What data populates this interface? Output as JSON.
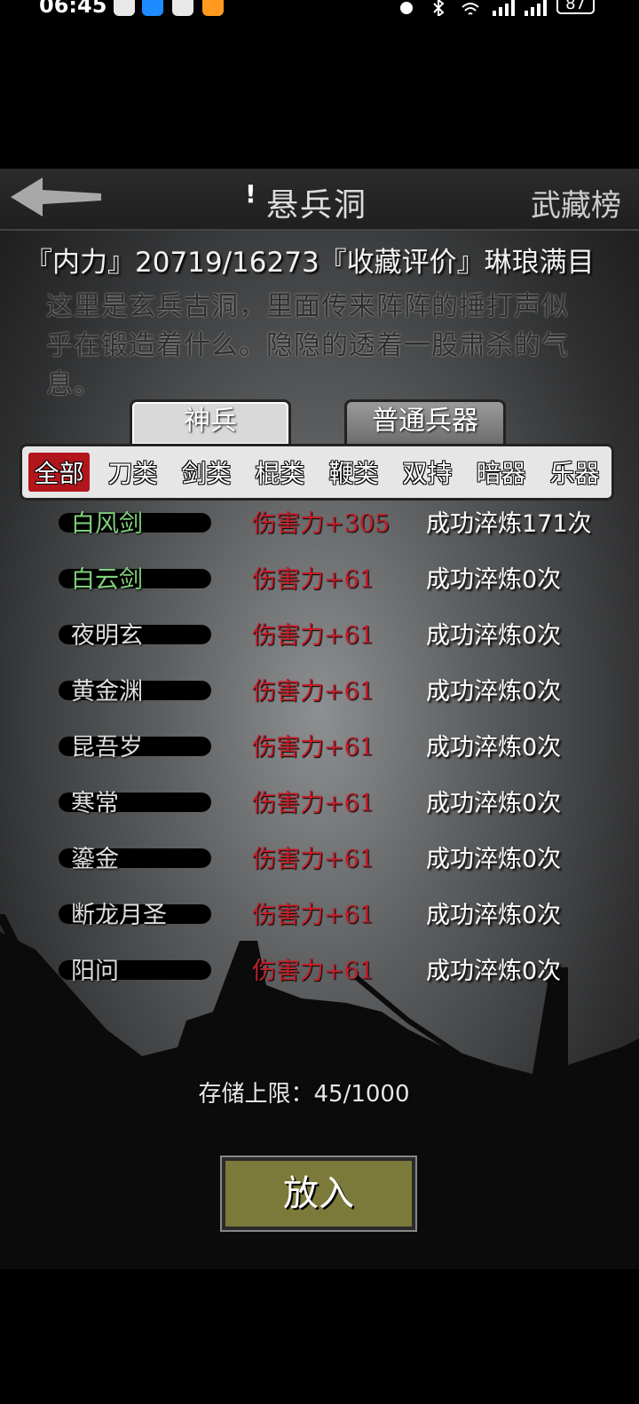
{
  "status_bar": {
    "time": "06:45",
    "battery": "87"
  },
  "header": {
    "title_mark": "!",
    "title": "悬兵洞",
    "ranking_label": "武藏榜"
  },
  "stats_line": "『内力』20719/16273『收藏评价』琳琅满目",
  "description": "这里是玄兵古洞，里面传来阵阵的捶打声似乎在锻造着什么。隐隐的透着一股肃杀的气息。",
  "tabs": [
    {
      "label": "神兵",
      "active": true
    },
    {
      "label": "普通兵器",
      "active": false
    }
  ],
  "categories": [
    {
      "label": "全部",
      "active": true
    },
    {
      "label": "刀类"
    },
    {
      "label": "剑类"
    },
    {
      "label": "棍类"
    },
    {
      "label": "鞭类"
    },
    {
      "label": "双持"
    },
    {
      "label": "暗器"
    },
    {
      "label": "乐器"
    }
  ],
  "weapons": [
    {
      "name": "白风剑",
      "damage": "伤害力+305",
      "refine": "成功淬炼171次",
      "name_color": "green"
    },
    {
      "name": "白云剑",
      "damage": "伤害力+61",
      "refine": "成功淬炼0次",
      "name_color": "green"
    },
    {
      "name": "夜明玄",
      "damage": "伤害力+61",
      "refine": "成功淬炼0次",
      "name_color": "white"
    },
    {
      "name": "黄金渊",
      "damage": "伤害力+61",
      "refine": "成功淬炼0次",
      "name_color": "white"
    },
    {
      "name": "昆吾岁",
      "damage": "伤害力+61",
      "refine": "成功淬炼0次",
      "name_color": "white"
    },
    {
      "name": "寒常",
      "damage": "伤害力+61",
      "refine": "成功淬炼0次",
      "name_color": "white"
    },
    {
      "name": "鎏金",
      "damage": "伤害力+61",
      "refine": "成功淬炼0次",
      "name_color": "white"
    },
    {
      "name": "断龙月圣",
      "damage": "伤害力+61",
      "refine": "成功淬炼0次",
      "name_color": "white"
    },
    {
      "name": "阳问",
      "damage": "伤害力+61",
      "refine": "成功淬炼0次",
      "name_color": "white"
    }
  ],
  "storage_label": "存储上限：45/1000",
  "put_in_label": "放入"
}
